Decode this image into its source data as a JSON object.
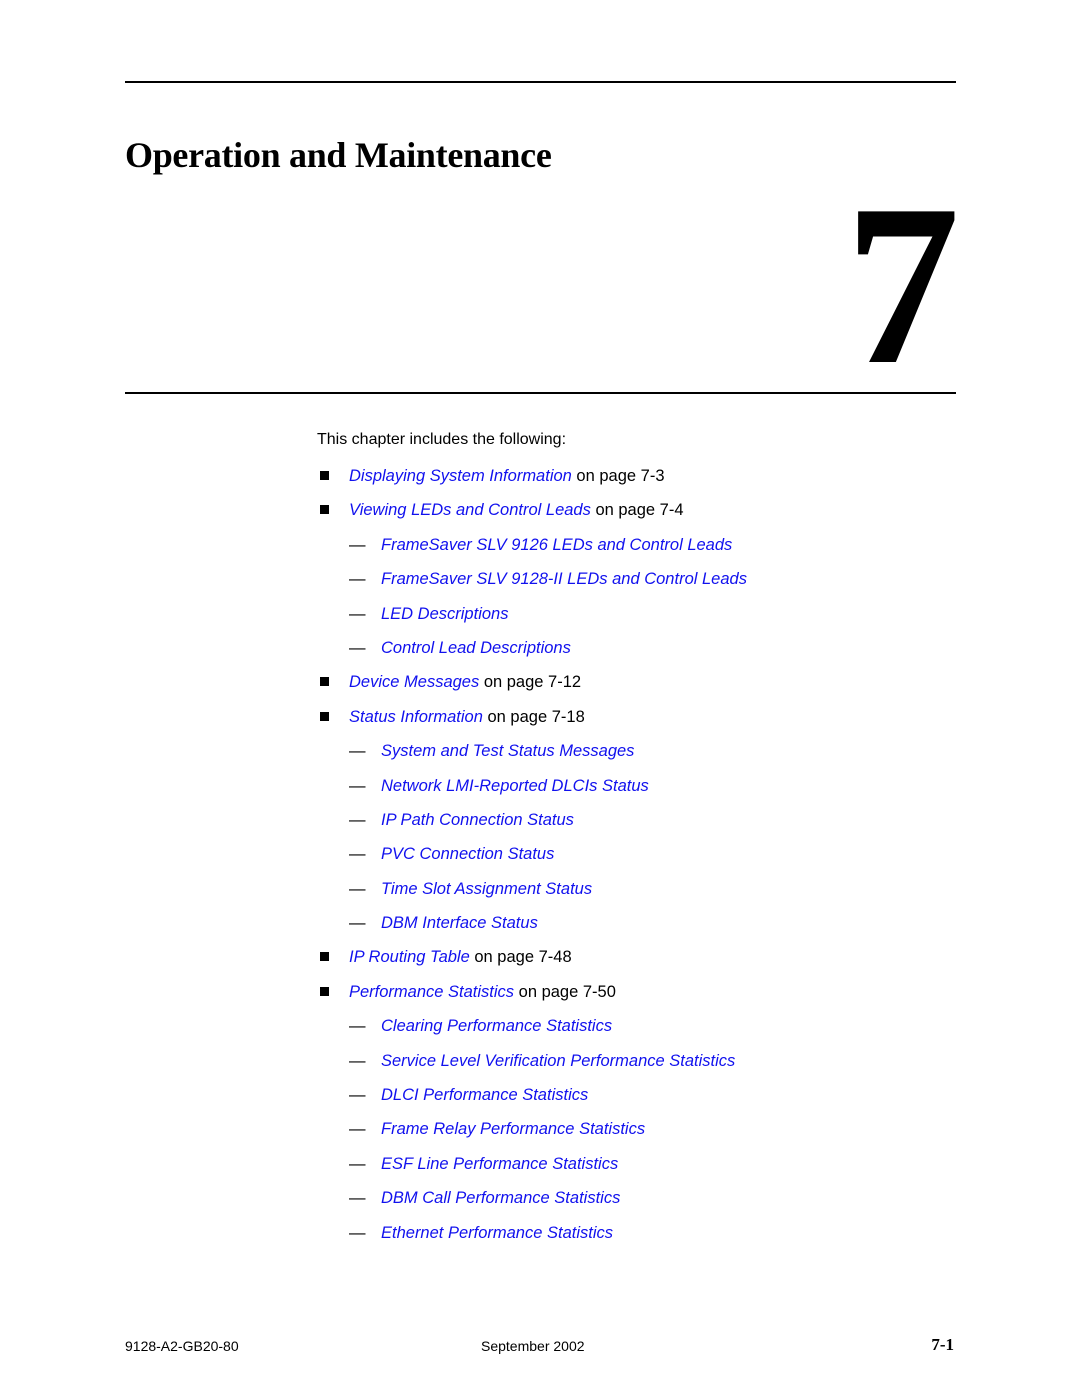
{
  "chapter": {
    "title": "Operation and Maintenance",
    "number": "7"
  },
  "intro": "This chapter includes the following:",
  "toc": [
    {
      "level": 1,
      "link": "Displaying System Information",
      "suffix": " on page 7-3"
    },
    {
      "level": 1,
      "link": "Viewing LEDs and Control Leads",
      "suffix": " on page 7-4"
    },
    {
      "level": 2,
      "link": "FrameSaver SLV 9126 LEDs and Control Leads",
      "suffix": ""
    },
    {
      "level": 2,
      "link": "FrameSaver SLV 9128-II LEDs and Control Leads",
      "suffix": ""
    },
    {
      "level": 2,
      "link": "LED Descriptions",
      "suffix": ""
    },
    {
      "level": 2,
      "link": "Control Lead Descriptions",
      "suffix": ""
    },
    {
      "level": 1,
      "link": "Device Messages",
      "suffix": " on page 7-12"
    },
    {
      "level": 1,
      "link": "Status Information",
      "suffix": " on page 7-18"
    },
    {
      "level": 2,
      "link": "System and Test Status Messages",
      "suffix": ""
    },
    {
      "level": 2,
      "link": "Network LMI-Reported DLCIs Status",
      "suffix": ""
    },
    {
      "level": 2,
      "link": "IP Path Connection Status",
      "suffix": ""
    },
    {
      "level": 2,
      "link": "PVC Connection Status",
      "suffix": ""
    },
    {
      "level": 2,
      "link": "Time Slot Assignment Status",
      "suffix": ""
    },
    {
      "level": 2,
      "link": "DBM Interface Status",
      "suffix": ""
    },
    {
      "level": 1,
      "link": "IP Routing Table",
      "suffix": " on page 7-48"
    },
    {
      "level": 1,
      "link": "Performance Statistics",
      "suffix": " on page 7-50"
    },
    {
      "level": 2,
      "link": "Clearing Performance Statistics",
      "suffix": ""
    },
    {
      "level": 2,
      "link": "Service Level Verification Performance Statistics",
      "suffix": ""
    },
    {
      "level": 2,
      "link": "DLCI Performance Statistics",
      "suffix": ""
    },
    {
      "level": 2,
      "link": "Frame Relay Performance Statistics",
      "suffix": ""
    },
    {
      "level": 2,
      "link": "ESF Line Performance Statistics",
      "suffix": ""
    },
    {
      "level": 2,
      "link": "DBM Call Performance Statistics",
      "suffix": ""
    },
    {
      "level": 2,
      "link": "Ethernet Performance Statistics",
      "suffix": ""
    }
  ],
  "dash_glyph": "—",
  "footer": {
    "doc_number": "9128-A2-GB20-80",
    "date": "September 2002",
    "page": "7-1"
  },
  "colors": {
    "link": "#1111ee",
    "text": "#000000"
  }
}
